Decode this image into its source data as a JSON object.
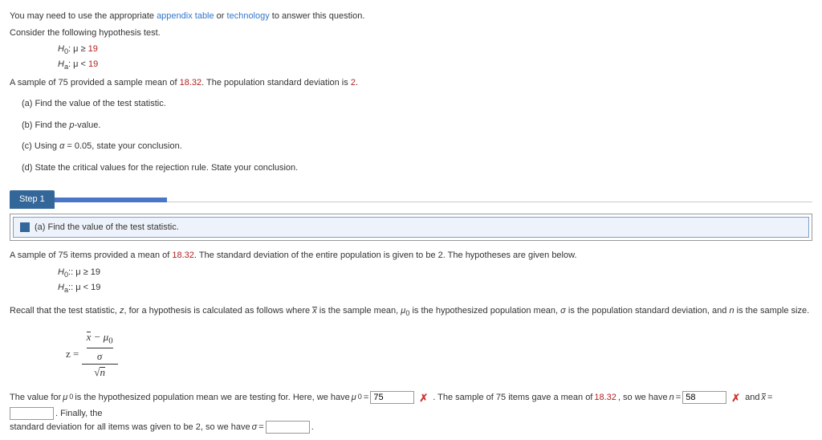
{
  "intro": {
    "t1a": "You may need to use the appropriate ",
    "t1b": "appendix table",
    "t1c": " or ",
    "t1d": "technology",
    "t1e": " to answer this question.",
    "t2": "Consider the following hypothesis test."
  },
  "hyp": {
    "h0a": "H",
    "h0b": "0",
    "h0c": ": μ ≥ ",
    "h0v": "19",
    "h1a": "H",
    "h1b": "a",
    "h1c": ": μ < ",
    "h1v": "19"
  },
  "sample": {
    "s1": "A sample of 75 provided a sample mean of ",
    "s2": "18.32",
    "s3": ". The population standard deviation is ",
    "s4": "2",
    "s5": "."
  },
  "q": {
    "a": "(a)   Find the value of the test statistic.",
    "b_pre": "(b)   Find the ",
    "b_i": "p",
    "b_post": "-value.",
    "c_pre": "(c)   Using ",
    "c_a": "α",
    "c_mid": " = 0.05, state your conclusion.",
    "d": "(d)   State the critical values for the rejection rule. State your conclusion."
  },
  "step": {
    "label": "Step 1",
    "head": "(a)   Find the value of the test statistic.",
    "p1a": "A sample of 75 items provided a mean of ",
    "p1b": "18.32",
    "p1c": ". The standard deviation of the entire population is given to be 2. The hypotheses are given below.",
    "p2a": "Recall that the test statistic, ",
    "p2z": "z",
    "p2b": ", for a hypothesis is calculated as follows where ",
    "p2x": "x",
    "p2c": " is the sample mean, ",
    "p2mu": "μ",
    "p2mu0": "0",
    "p2d": " is the hypothesized population mean, ",
    "p2sig": "σ",
    "p2e": " is the population standard deviation, and ",
    "p2n": "n",
    "p2f": " is the sample size.",
    "fz": "z = ",
    "fnum_x": "x",
    "fnum_m": " − μ",
    "fnum_0": "0",
    "fmid": "σ",
    "fbot_pre": "√",
    "fbot_n": "n",
    "l1": "The value for ",
    "l2": "μ",
    "l2s": "0",
    "l3": " is the hypothesized population mean we are testing for. Here, we have ",
    "l4": "μ",
    "l4s": "0",
    "l5": " = ",
    "inp1": "75",
    "l6": " . The sample of 75 items gave a mean of ",
    "l7": "18.32",
    "l8": ", so we have ",
    "l9": "n",
    "l10": " = ",
    "inp2": "58",
    "l11": " and ",
    "l12": "x",
    "l13": " = ",
    "inp3": "",
    "l14": " . Finally, the",
    "l15": "standard deviation for all items was given to be 2, so we have ",
    "l16": "σ",
    "l17": " = ",
    "inp4": "",
    "l18": " ."
  }
}
